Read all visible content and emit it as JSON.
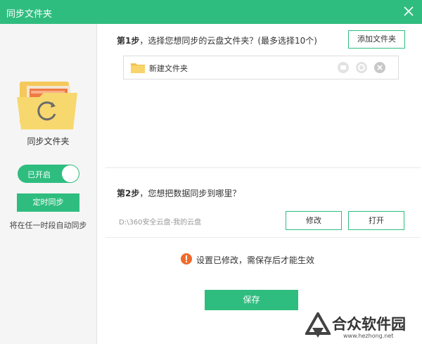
{
  "window": {
    "title": "同步文件夹"
  },
  "sidebar": {
    "label": "同步文件夹",
    "toggle_label": "已开启",
    "timer_button": "定时同步",
    "description": "将在任一时段自动同步"
  },
  "step1": {
    "prefix": "第1步",
    "text": "，选择您想同步的云盘文件夹？(最多选择10个)",
    "add_button": "添加文件夹",
    "folders": [
      {
        "name": "新建文件夹"
      }
    ]
  },
  "step2": {
    "prefix": "第2步",
    "text": "，您想把数据同步到哪里？",
    "path": "D:\\360安全云盘-我的云盘",
    "modify_button": "修改",
    "open_button": "打开"
  },
  "notice": {
    "text": "设置已修改，需保存后才能生效"
  },
  "save_button": "保存",
  "watermark": {
    "title": "合众软件园",
    "url": "www.hezhong.net"
  },
  "colors": {
    "accent": "#2fbd7f",
    "warning": "#f06a2b"
  }
}
